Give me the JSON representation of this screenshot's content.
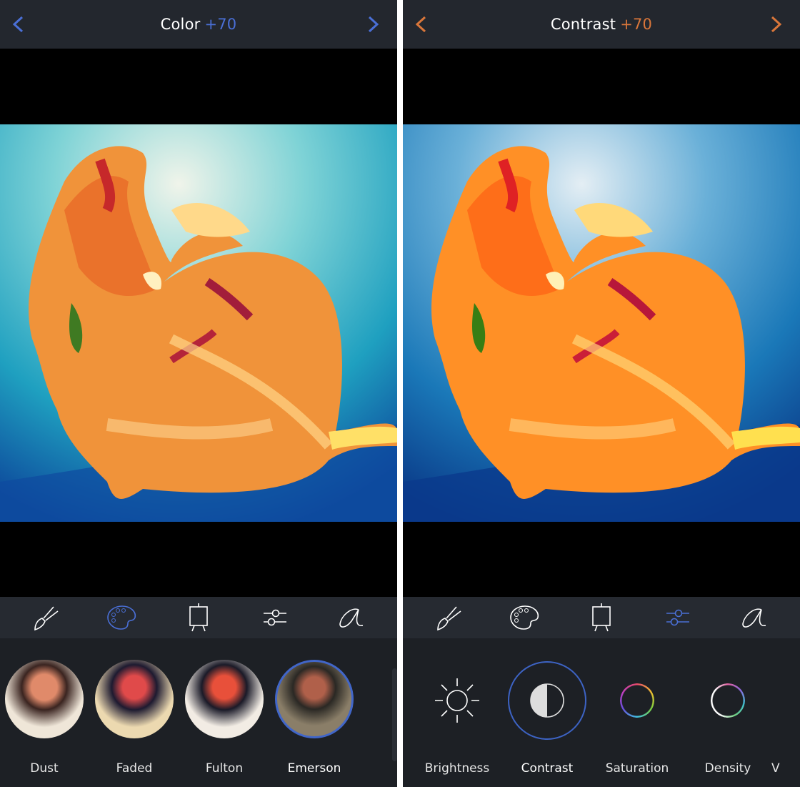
{
  "left": {
    "header": {
      "title": "Color",
      "value": "+70",
      "accent": "#4a6fd6"
    },
    "toolbar": {
      "tools": [
        "brush-icon",
        "palette-icon",
        "easel-icon",
        "sliders-icon",
        "font-icon"
      ],
      "active": "palette-icon"
    },
    "filters": [
      {
        "label": "Dust"
      },
      {
        "label": "Faded"
      },
      {
        "label": "Fulton"
      },
      {
        "label": "Emerson",
        "selected": true
      }
    ]
  },
  "right": {
    "header": {
      "title": "Contrast",
      "value": "+70",
      "accent": "#d9763a"
    },
    "toolbar": {
      "tools": [
        "brush-icon",
        "palette-icon",
        "easel-icon",
        "sliders-icon",
        "font-icon"
      ],
      "active": "sliders-icon"
    },
    "adjustments": [
      {
        "label": "Brightness",
        "icon": "sun-icon"
      },
      {
        "label": "Contrast",
        "icon": "contrast-icon",
        "selected": true
      },
      {
        "label": "Saturation",
        "icon": "color-ring-icon"
      },
      {
        "label": "Density",
        "icon": "density-ring-icon"
      },
      {
        "label": "V"
      }
    ]
  }
}
